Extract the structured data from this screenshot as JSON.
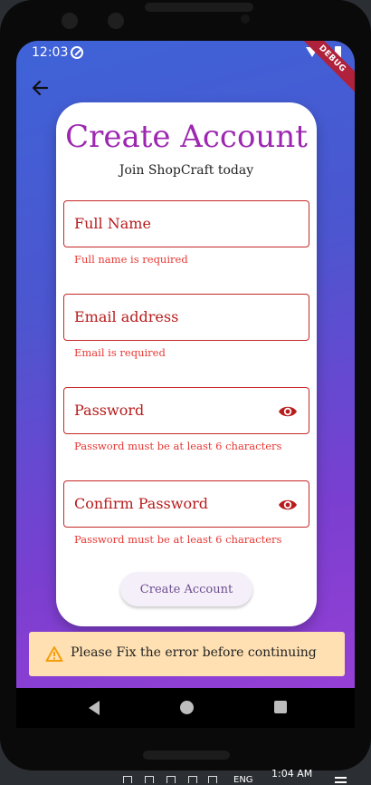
{
  "status_bar": {
    "time": "12:03",
    "debug_label": "DEBUG"
  },
  "card": {
    "title": "Create Account",
    "subtitle": "Join ShopCraft today"
  },
  "fields": [
    {
      "label": "Full Name",
      "error": "Full name is required",
      "has_toggle": false
    },
    {
      "label": "Email address",
      "error": "Email is required",
      "has_toggle": false
    },
    {
      "label": "Password",
      "error": "Password must be at least 6 characters",
      "has_toggle": true
    },
    {
      "label": "Confirm Password",
      "error": "Password must be at least 6 characters",
      "has_toggle": true
    }
  ],
  "submit_label": "Create Account",
  "snackbar": {
    "message": "Please Fix the error before continuing",
    "icon": "warning-icon"
  },
  "taskbar": {
    "time": "1:04 AM",
    "lang": "ENG"
  },
  "colors": {
    "title": "#9c27b0",
    "error": "#e53935",
    "field_border": "#c62828",
    "snackbar_bg": "#ffe0b2",
    "gradient_start": "#3f63d8",
    "gradient_end": "#9b3fd6"
  }
}
